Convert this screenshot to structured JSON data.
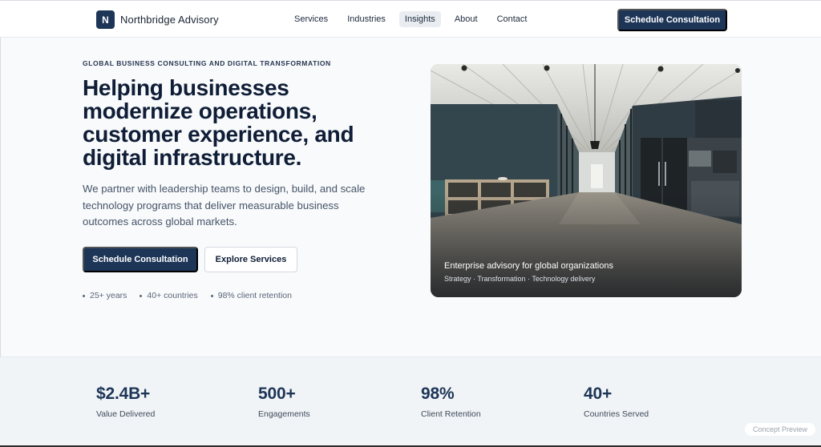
{
  "brand": {
    "logo_letter": "N",
    "name": "Northbridge Advisory"
  },
  "nav": {
    "links": [
      "Services",
      "Industries",
      "Insights",
      "About",
      "Contact"
    ],
    "active": "Insights",
    "cta": "Schedule Consultation"
  },
  "hero": {
    "eyebrow": "GLOBAL BUSINESS CONSULTING AND DIGITAL TRANSFORMATION",
    "headline": "Helping businesses modernize operations, customer experience, and digital infrastructure.",
    "lede": "We partner with leadership teams to design, build, and scale technology programs that deliver measurable business outcomes across global markets.",
    "primary_cta": "Schedule Consultation",
    "secondary_cta": "Explore Services",
    "quick_stats": [
      "25+ years",
      "40+ countries",
      "98% client retention"
    ]
  },
  "hero_card": {
    "title": "Enterprise advisory for global organizations",
    "subtitle": "Strategy · Transformation · Technology delivery"
  },
  "metrics": [
    {
      "value": "$2.4B+",
      "label": "Value Delivered"
    },
    {
      "value": "500+",
      "label": "Engagements"
    },
    {
      "value": "98%",
      "label": "Client Retention"
    },
    {
      "value": "40+",
      "label": "Countries Served"
    }
  ],
  "badge": "Concept Preview",
  "colors": {
    "primary": "#1d3557",
    "text": "#0f1d36",
    "muted": "#465467",
    "background": "#f8fafc"
  }
}
